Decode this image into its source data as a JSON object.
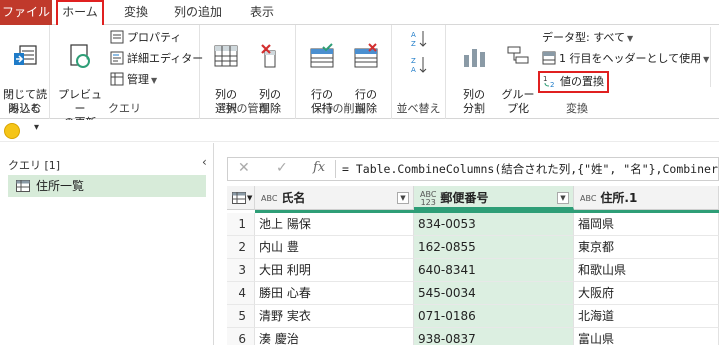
{
  "menu": {
    "file": "ファイル",
    "tabs": [
      "ホーム",
      "変換",
      "列の追加",
      "表示"
    ]
  },
  "ribbon": {
    "close": {
      "button": "閉じて読\nみ込む",
      "group": "閉じる"
    },
    "query": {
      "preview": "プレビュー\nの更新",
      "properties": "プロパティ",
      "advanced_editor": "詳細エディター",
      "manage": "管理",
      "group": "クエリ"
    },
    "columns": {
      "select": "列の\n選択",
      "delete": "列の\n削除",
      "group": "列の管理"
    },
    "rows": {
      "keep": "行の\n保持",
      "delete": "行の\n削除",
      "group": "行の削減"
    },
    "sort": {
      "group": "並べ替え"
    },
    "transform": {
      "split": "列の\n分割",
      "group_by": "グルー\nプ化",
      "data_type": "データ型: すべて",
      "use_header": "1 行目をヘッダーとして使用",
      "replace": "値の置換",
      "group": "変換"
    }
  },
  "queries": {
    "header": "クエリ [1]",
    "items": [
      "住所一覧"
    ]
  },
  "formula": {
    "text": "= Table.CombineColumns(結合された列,{\"姓\", \"名\"},Combiner."
  },
  "grid": {
    "columns": [
      {
        "name": "氏名",
        "type": "ABC"
      },
      {
        "name": "郵便番号",
        "type": "ABC\n123"
      },
      {
        "name": "住所.1",
        "type": "ABC"
      }
    ],
    "rows": [
      {
        "n": "1",
        "name": "池上 陽保",
        "zip": "834-0053",
        "addr": "福岡県"
      },
      {
        "n": "2",
        "name": "内山 豊",
        "zip": "162-0855",
        "addr": "東京都"
      },
      {
        "n": "3",
        "name": "大田 利明",
        "zip": "640-8341",
        "addr": "和歌山県"
      },
      {
        "n": "4",
        "name": "勝田 心春",
        "zip": "545-0034",
        "addr": "大阪府"
      },
      {
        "n": "5",
        "name": "清野 実衣",
        "zip": "071-0186",
        "addr": "北海道"
      },
      {
        "n": "6",
        "name": "湊 慶治",
        "zip": "938-0837",
        "addr": "富山県"
      }
    ]
  },
  "colors": {
    "file_tab": "#c0392b",
    "highlight": "#e02020",
    "selected_column": "#dcefe1",
    "accent": "#2e9e77"
  }
}
